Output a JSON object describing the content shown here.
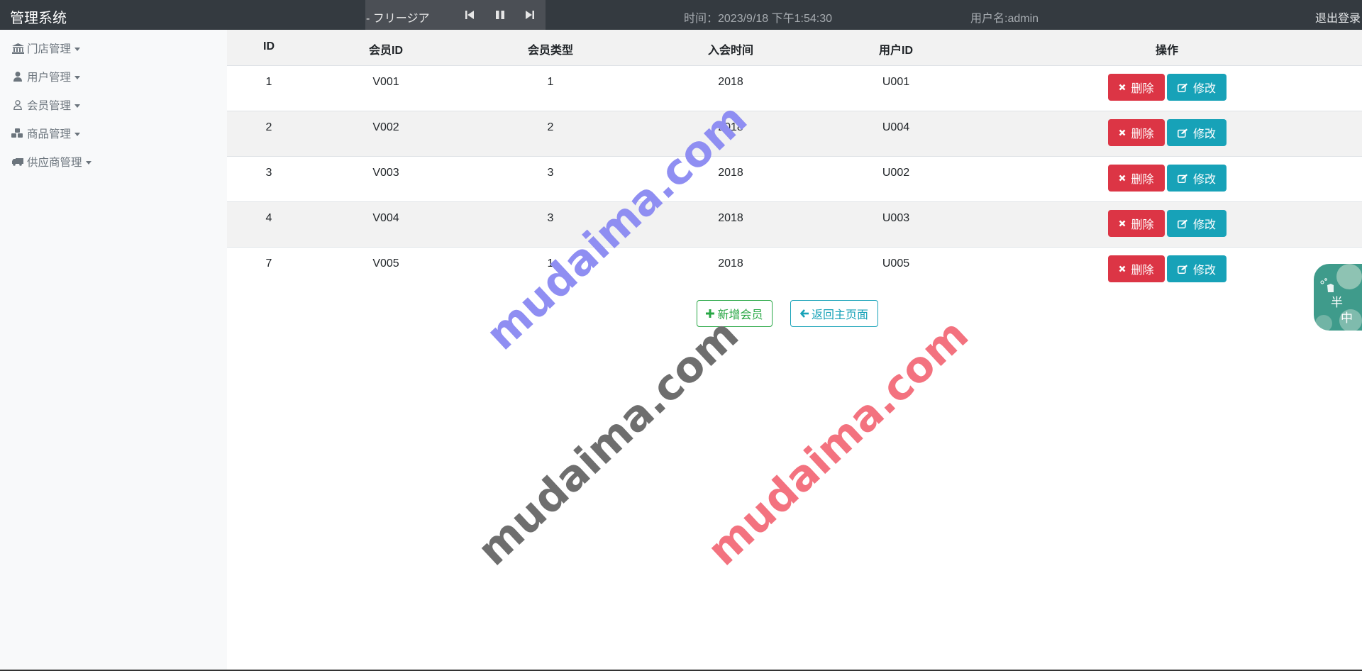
{
  "header": {
    "brand": "管理系统",
    "player": {
      "song": "- フリージア"
    },
    "time_text": "时间：2023/9/18 下午1:54:30",
    "user_text": "用户名:admin",
    "logout": "退出登录"
  },
  "sidebar": {
    "items": [
      {
        "label": "门店管理",
        "icon": "bank-icon"
      },
      {
        "label": "用户管理",
        "icon": "user-icon"
      },
      {
        "label": "会员管理",
        "icon": "user-outline-icon"
      },
      {
        "label": "商品管理",
        "icon": "cubes-icon"
      },
      {
        "label": "供应商管理",
        "icon": "truck-icon"
      }
    ]
  },
  "table": {
    "headers": [
      "ID",
      "会员ID",
      "会员类型",
      "入会时间",
      "用户ID",
      "操作"
    ],
    "rows": [
      [
        "1",
        "V001",
        "1",
        "2018",
        "U001"
      ],
      [
        "2",
        "V002",
        "2",
        "2018",
        "U004"
      ],
      [
        "3",
        "V003",
        "3",
        "2018",
        "U002"
      ],
      [
        "4",
        "V004",
        "3",
        "2018",
        "U003"
      ],
      [
        "7",
        "V005",
        "1",
        "2018",
        "U005"
      ]
    ],
    "delete_label": "删除",
    "edit_label": "修改"
  },
  "actions": {
    "add_label": "新增会员",
    "back_label": "返回主页面"
  },
  "watermarks": [
    "mudaima.com",
    "mudaima.com",
    "mudaima.com"
  ],
  "widget": {
    "line1": "半",
    "line2": "中"
  },
  "colors": {
    "topbar": "#343a40",
    "sidebar": "#f8f9fa",
    "danger": "#dc3545",
    "info": "#17a2b8",
    "success": "#28a745",
    "watermark_purple": "#8f8ef2",
    "watermark_gray": "#6e6e6e",
    "watermark_pink": "#f3727f"
  }
}
